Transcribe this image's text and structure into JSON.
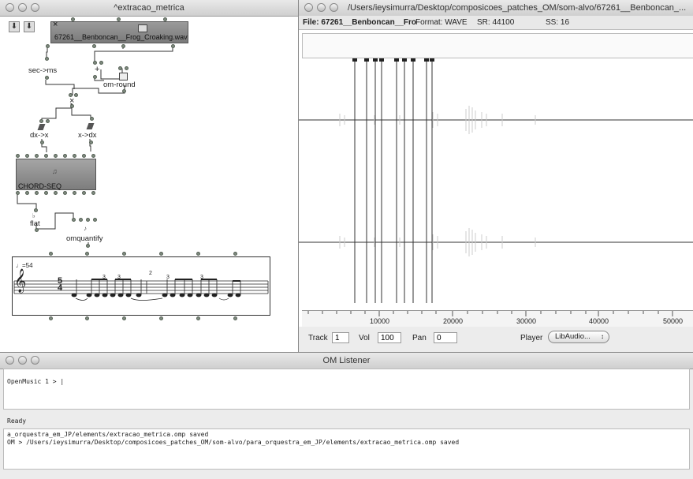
{
  "patch": {
    "title": "^extracao_metrica",
    "tool_arrows": [
      "⬇",
      "⬇"
    ],
    "sound_box_label": "67261__Benboncan__Frog_Croaking.wav",
    "sound_box_close": "×",
    "nodes": {
      "sec_to_ms": "sec->ms",
      "plus": "+",
      "om_round": "om-round",
      "times": "×",
      "dx_to_x": "dx->x",
      "x_to_dx": "x->dx",
      "chord_seq": "CHORD-SEQ",
      "flat": "flat",
      "omquantify": "omquantify"
    },
    "score": {
      "tempo": "♩=54",
      "clef": "𝄞",
      "time_sig_top": "5",
      "time_sig_bottom": "4",
      "tuplet_labels": [
        "3",
        "3",
        "3",
        "3"
      ],
      "measure_number": "2"
    }
  },
  "sound_window": {
    "title": "/Users/ieysimurra/Desktop/composicoes_patches_OM/som-alvo/67261__Benboncan_...",
    "file_label": "File: 67261__Benboncan__Fro",
    "format": "Format: WAVE",
    "sr": "SR: 44100",
    "ss": "SS: 16",
    "ruler_ticks": [
      "10000",
      "20000",
      "30000",
      "40000",
      "50000"
    ],
    "track_label": "Track",
    "track_value": "1",
    "vol_label": "Vol",
    "vol_value": "100",
    "pan_label": "Pan",
    "pan_value": "0",
    "player_label": "Player",
    "player_value": "LibAudio..."
  },
  "listener": {
    "title": "OM Listener",
    "prompt": "OpenMusic 1 > |",
    "status": "Ready",
    "log": [
      "a_orquestra_em_JP/elements/extracao_metrica.omp saved",
      "OM > /Users/ieysimurra/Desktop/composicoes_patches_OM/som-alvo/para_orquestra_em_JP/elements/extracao_metrica.omp saved"
    ]
  }
}
